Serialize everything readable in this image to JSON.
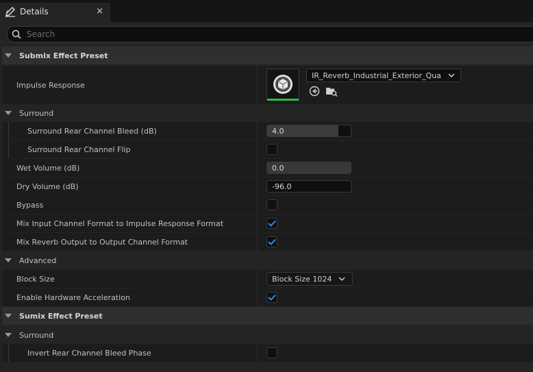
{
  "tab": {
    "title": "Details",
    "close": "×",
    "icon": "edit-icon"
  },
  "search": {
    "placeholder": "Search",
    "value": ""
  },
  "sections": {
    "submix": {
      "title": "Submix Effect Preset"
    },
    "impulse": {
      "label": "Impulse Response",
      "asset": "IR_Reverb_Industrial_Exterior_Quad_IR",
      "browse_icon": "browse-back-icon",
      "find_icon": "find-in-folder-icon",
      "thumb_icon": "cube-icon"
    },
    "surround": {
      "title": "Surround",
      "bleed_label": "Surround Rear Channel Bleed (dB)",
      "bleed_value": "4.0",
      "bleed_fill": 0.85,
      "flip_label": "Surround Rear Channel Flip"
    },
    "wet": {
      "label": "Wet Volume (dB)",
      "value": "0.0"
    },
    "dry": {
      "label": "Dry Volume (dB)",
      "value": "-96.0"
    },
    "bypass": {
      "label": "Bypass"
    },
    "mix_input": {
      "label": "Mix Input Channel Format to Impulse Response Format",
      "checked": true
    },
    "mix_reverb": {
      "label": "Mix Reverb Output to Output Channel Format",
      "checked": true
    },
    "advanced": {
      "title": "Advanced",
      "block_label": "Block Size",
      "block_value": "Block Size 1024",
      "hw_label": "Enable Hardware Acceleration",
      "hw_checked": true
    },
    "sumix": {
      "title": "Sumix Effect Preset"
    },
    "surround2": {
      "title": "Surround",
      "invert_label": "Invert Rear Channel Bleed Phase"
    }
  },
  "colors": {
    "accent": "#2f82d9",
    "thumb_underline": "#2bbf4a"
  }
}
